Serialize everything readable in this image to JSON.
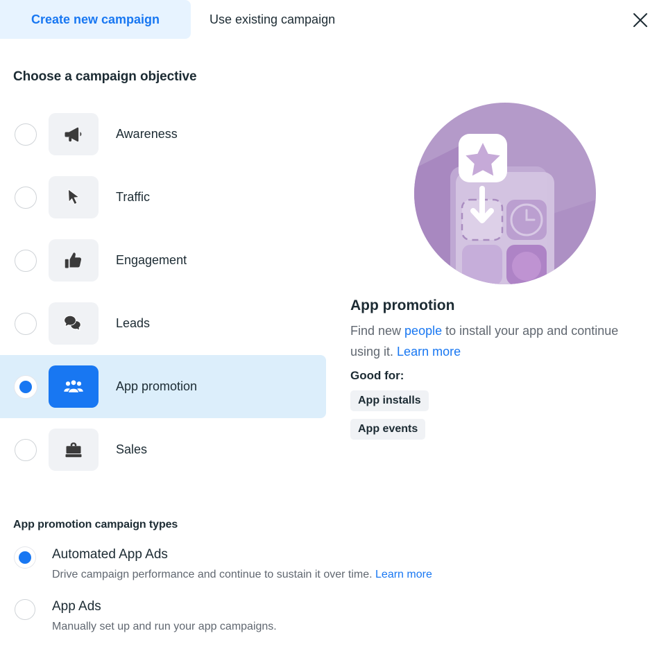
{
  "tabs": {
    "active_label": "Create new campaign",
    "inactive_label": "Use existing campaign",
    "close_icon": "close-icon",
    "accent_color": "#1877f2",
    "active_tab_bg": "#e7f3ff"
  },
  "objective_section": {
    "heading": "Choose a campaign objective",
    "selected": "App promotion",
    "items": [
      {
        "label": "Awareness",
        "icon": "megaphone-icon",
        "selected": false
      },
      {
        "label": "Traffic",
        "icon": "cursor-icon",
        "selected": false
      },
      {
        "label": "Engagement",
        "icon": "thumbs-up-icon",
        "selected": false
      },
      {
        "label": "Leads",
        "icon": "chat-bubbles-icon",
        "selected": false
      },
      {
        "label": "App promotion",
        "icon": "people-group-icon",
        "selected": true
      },
      {
        "label": "Sales",
        "icon": "briefcase-icon",
        "selected": false
      }
    ]
  },
  "detail": {
    "illustration": "app-promotion-illustration",
    "title": "App promotion",
    "desc_part1": "Find new ",
    "desc_link1": "people",
    "desc_part2": " to install your app and continue using it. ",
    "desc_link2": "Learn more",
    "good_for_label": "Good for:",
    "tags": [
      "App installs",
      "App events"
    ]
  },
  "campaign_types": {
    "heading": "App promotion campaign types",
    "items": [
      {
        "title": "Automated App Ads",
        "desc": "Drive campaign performance and continue to sustain it over time. ",
        "link": "Learn more",
        "selected": true
      },
      {
        "title": "App Ads",
        "desc": "Manually set up and run your app campaigns.",
        "link": "",
        "selected": false
      }
    ]
  },
  "colors": {
    "accent": "#1877f2",
    "selected_row_bg": "#dceefb",
    "icon_tile_bg": "#f0f2f5",
    "text_primary": "#1c2b33",
    "text_secondary": "#606770",
    "illustration_purple": "#b095c8"
  }
}
